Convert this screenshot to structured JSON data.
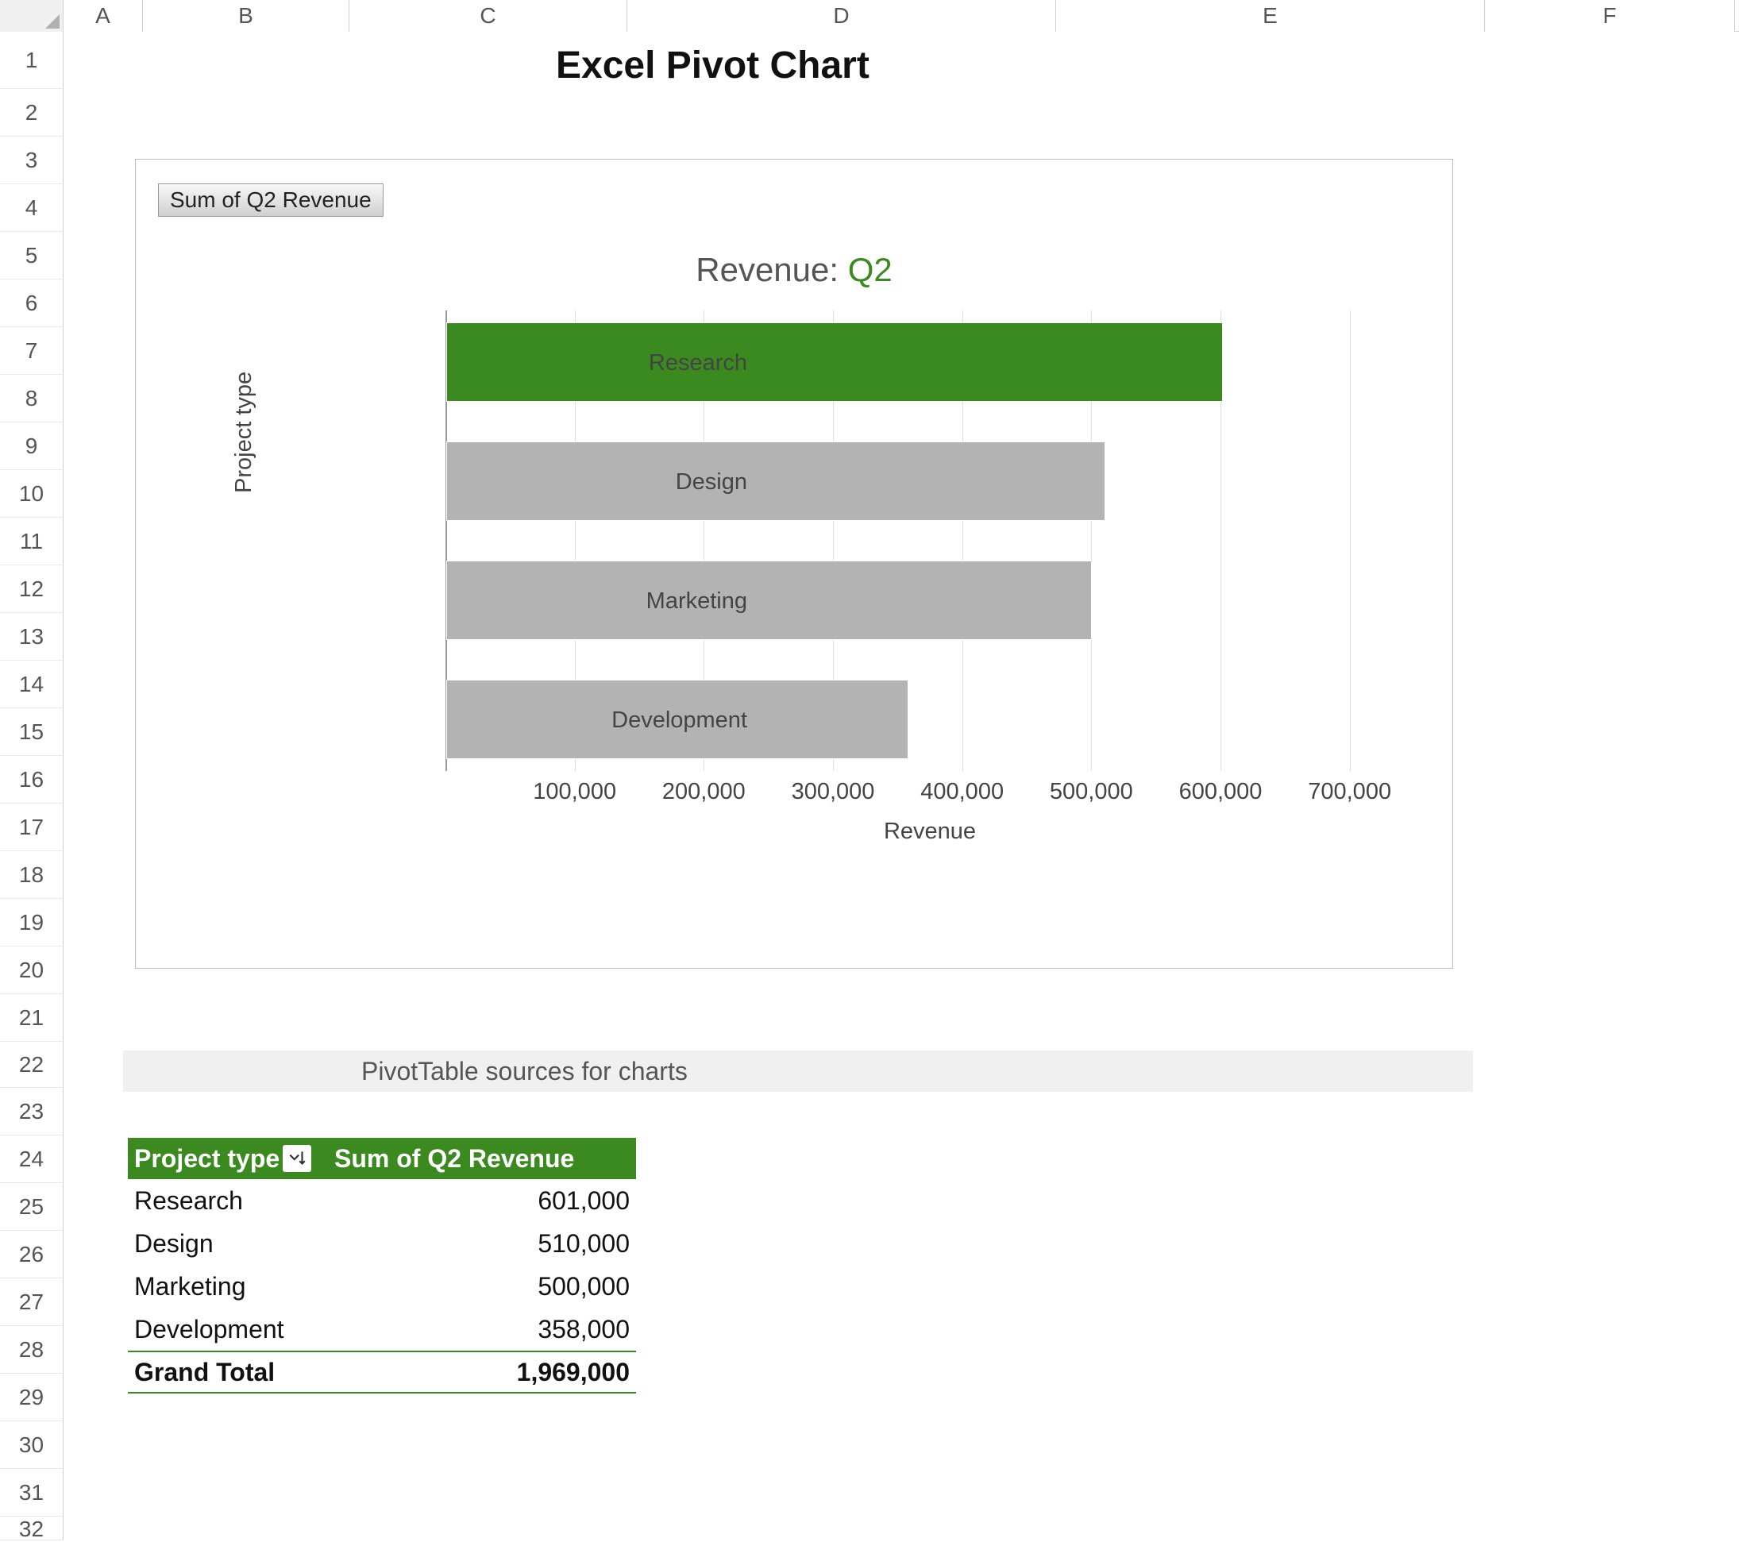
{
  "columns": [
    "A",
    "B",
    "C",
    "D",
    "E",
    "F"
  ],
  "rows_count": 32,
  "page_title": "Excel Pivot Chart",
  "chart_badge": "Sum of Q2 Revenue",
  "chart_title_prefix": "Revenue: ",
  "chart_title_highlight": "Q2",
  "y_axis_title": "Project type",
  "x_axis_title": "Revenue",
  "pivot_banner": "PivotTable sources for charts",
  "pivot_header_a": "Project type",
  "pivot_header_b": "Sum of Q2 Revenue",
  "grand_total_label": "Grand Total",
  "grand_total_value": "1,969,000",
  "pivot_rows": [
    {
      "label": "Research",
      "value": "601,000"
    },
    {
      "label": "Design",
      "value": "510,000"
    },
    {
      "label": "Marketing",
      "value": "500,000"
    },
    {
      "label": "Development",
      "value": "358,000"
    }
  ],
  "x_ticks": [
    "100,000",
    "200,000",
    "300,000",
    "400,000",
    "500,000",
    "600,000",
    "700,000"
  ],
  "chart_data": {
    "type": "bar",
    "orientation": "horizontal",
    "title": "Revenue: Q2",
    "xlabel": "Revenue",
    "ylabel": "Project type",
    "xlim": [
      0,
      750000
    ],
    "categories": [
      "Research",
      "Design",
      "Marketing",
      "Development"
    ],
    "values": [
      601000,
      510000,
      500000,
      358000
    ],
    "highlight_category": "Research",
    "colors": {
      "highlight": "#3b8a1f",
      "default": "#b3b3b3"
    }
  }
}
